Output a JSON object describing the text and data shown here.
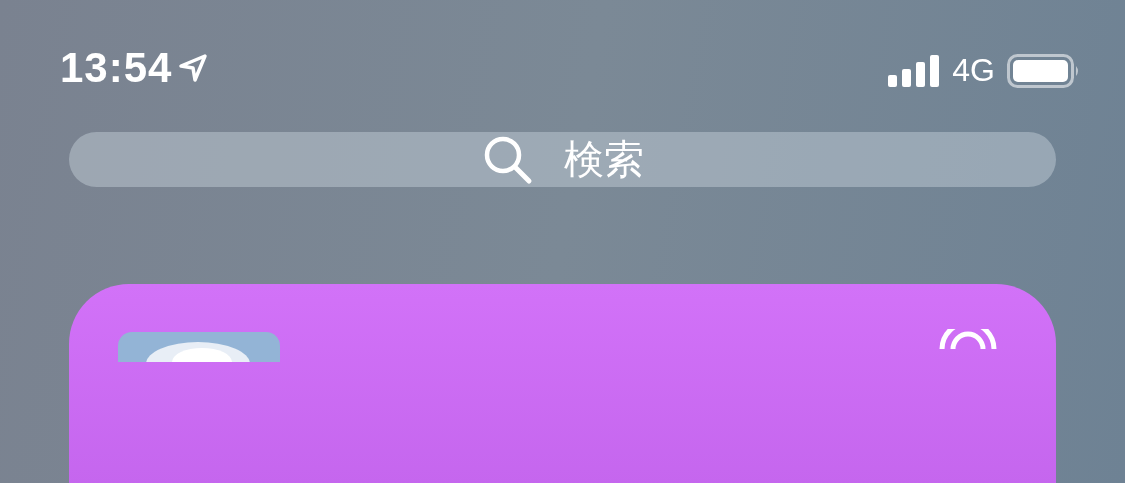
{
  "status_bar": {
    "time": "13:54",
    "network": "4G"
  },
  "search": {
    "placeholder": "検索"
  }
}
